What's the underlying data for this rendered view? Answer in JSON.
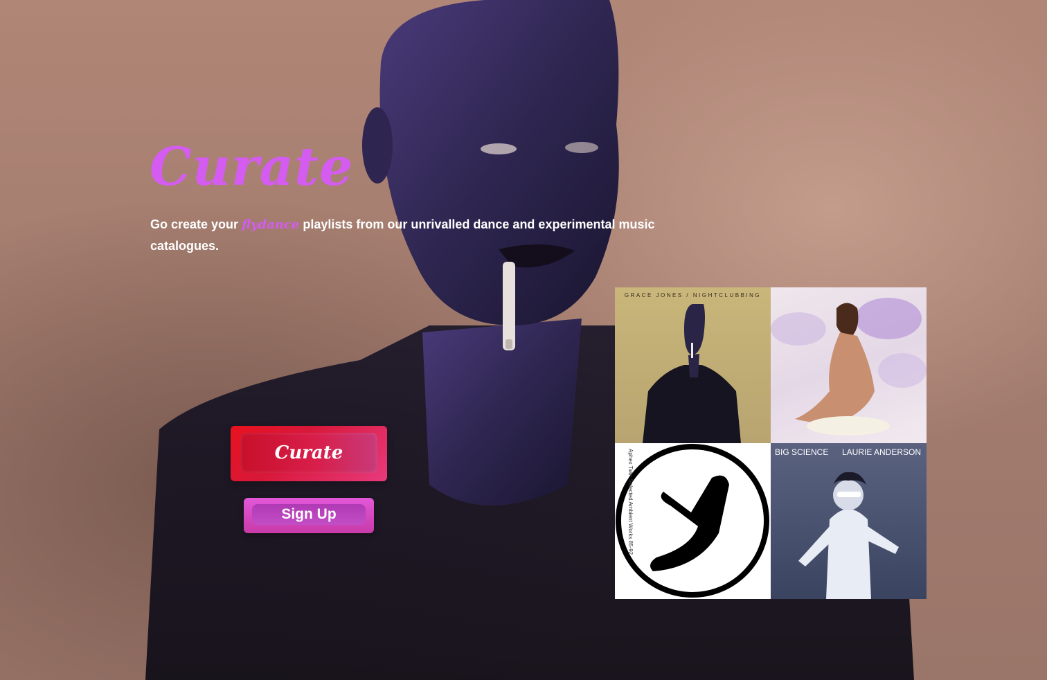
{
  "hero": {
    "title": "Curate",
    "subtitle_before": "Go create your ",
    "subtitle_brand": "flydance",
    "subtitle_after": " playlists from our unrivalled dance and experimental music catalogues."
  },
  "buttons": {
    "curate_label": "Curate",
    "signup_label": "Sign Up"
  },
  "albums": [
    {
      "cover_text": "GRACE JONES / NIGHTCLUBBING"
    },
    {
      "cover_text": ""
    },
    {
      "cover_text": "Aphex Twin Selected Ambient Works 85-92"
    },
    {
      "cover_text_left": "BIG SCIENCE",
      "cover_text_right": "LAURIE ANDERSON"
    }
  ],
  "colors": {
    "accent": "#d45cf0",
    "curate_button": "#d8183a",
    "signup_button": "#c83aa8"
  }
}
